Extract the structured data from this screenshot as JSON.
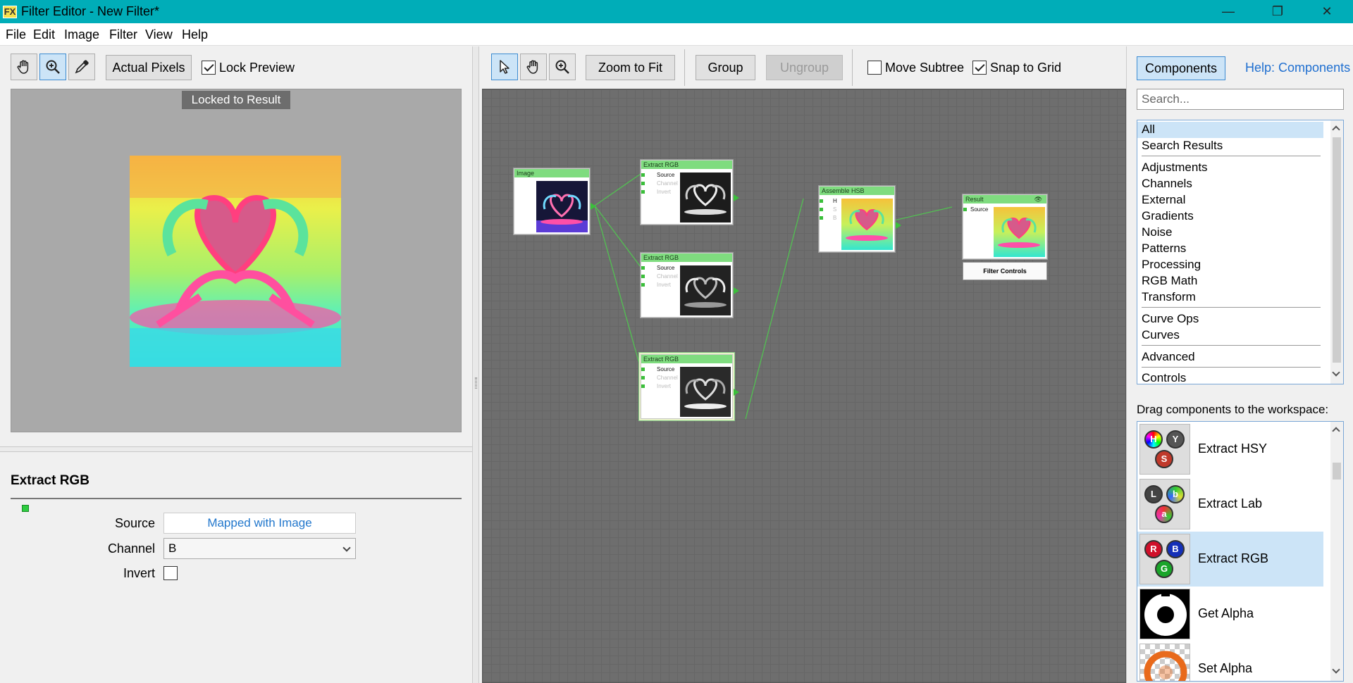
{
  "window": {
    "title": "Filter Editor - New Filter*",
    "app_icon": "FX",
    "minimize": "—",
    "restore": "❐",
    "close": "✕"
  },
  "menu": [
    "File",
    "Edit",
    "Image",
    "Filter",
    "View",
    "Help"
  ],
  "preview_toolbar": {
    "actual_pixels": "Actual Pixels",
    "lock_preview": "Lock Preview",
    "lock_preview_checked": true
  },
  "preview": {
    "locked_badge": "Locked to Result"
  },
  "properties": {
    "title": "Extract RGB",
    "source_label": "Source",
    "source_value": "Mapped with Image",
    "channel_label": "Channel",
    "channel_value": "B",
    "invert_label": "Invert",
    "invert_checked": false
  },
  "workspace_toolbar": {
    "zoom_to_fit": "Zoom to Fit",
    "group": "Group",
    "ungroup": "Ungroup",
    "move_subtree": "Move Subtree",
    "move_subtree_checked": false,
    "snap_to_grid": "Snap to Grid",
    "snap_to_grid_checked": true
  },
  "nodes": {
    "image": {
      "title": "Image"
    },
    "extract1": {
      "title": "Extract RGB",
      "ports": [
        "Source",
        "Channel",
        "Invert"
      ]
    },
    "extract2": {
      "title": "Extract RGB",
      "ports": [
        "Source",
        "Channel",
        "Invert"
      ]
    },
    "extract3": {
      "title": "Extract RGB",
      "ports": [
        "Source",
        "Channel",
        "Invert"
      ]
    },
    "assemble": {
      "title": "Assemble HSB",
      "ports": [
        "H",
        "S",
        "B"
      ]
    },
    "result": {
      "title": "Result",
      "ports": [
        "Source"
      ]
    },
    "filter_controls": "Filter Controls"
  },
  "components_panel": {
    "tab": "Components",
    "help_link": "Help: Components",
    "search_placeholder": "Search...",
    "categories": [
      "All",
      "Search Results",
      "Adjustments",
      "Channels",
      "External",
      "Gradients",
      "Noise",
      "Patterns",
      "Processing",
      "RGB Math",
      "Transform",
      "Curve Ops",
      "Curves",
      "Advanced",
      "Controls"
    ],
    "selected_category": "All",
    "drag_hint": "Drag components to the workspace:",
    "components": [
      {
        "name": "Extract HSY",
        "balls": [
          "H",
          "Y",
          "S"
        ]
      },
      {
        "name": "Extract Lab",
        "balls": [
          "L",
          "b",
          "a"
        ]
      },
      {
        "name": "Extract RGB",
        "balls": [
          "R",
          "B",
          "G"
        ]
      },
      {
        "name": "Get Alpha",
        "balls": []
      },
      {
        "name": "Set Alpha",
        "balls": []
      }
    ],
    "selected_component": "Extract RGB"
  }
}
